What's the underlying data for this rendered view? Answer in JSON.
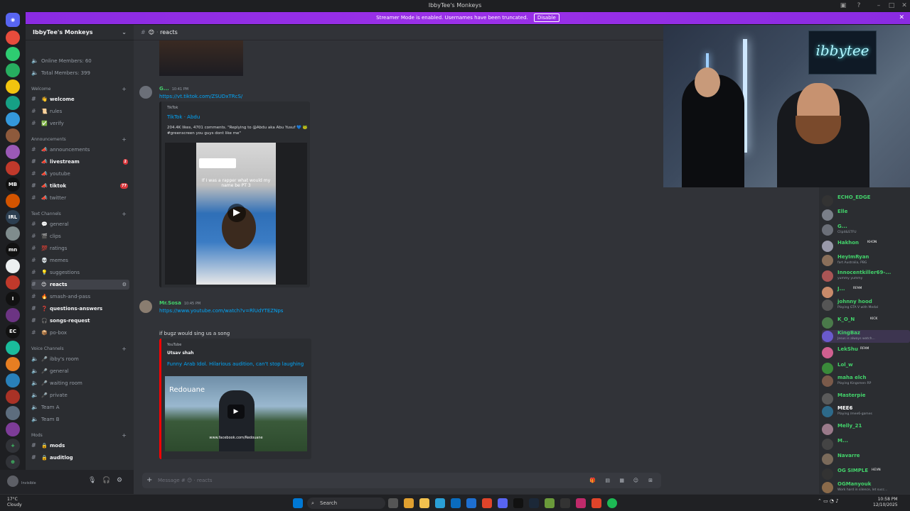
{
  "window": {
    "title": "IbbyTee's Monkeys"
  },
  "banner": {
    "text": "Streamer Mode is enabled. Usernames have been truncated.",
    "disable_label": "Disable"
  },
  "server": {
    "name": "IbbyTee's Monkeys"
  },
  "sidebar": {
    "stats": [
      {
        "label": "Online Members: 60"
      },
      {
        "label": "Total Members: 399"
      }
    ],
    "categories": {
      "welcome": "Welcome",
      "announcements": "Announcements",
      "text": "Text Channels",
      "voice": "Voice Channels",
      "mods": "Mods"
    },
    "welcome_channels": [
      {
        "label": "welcome"
      },
      {
        "label": "rules"
      },
      {
        "label": "verify"
      }
    ],
    "announce_channels": [
      {
        "label": "announcements"
      },
      {
        "label": "livestream",
        "badge": "2"
      },
      {
        "label": "youtube"
      },
      {
        "label": "tiktok",
        "badge": "77"
      },
      {
        "label": "twitter"
      }
    ],
    "text_channels": [
      {
        "label": "general"
      },
      {
        "label": "clips"
      },
      {
        "label": "ratings"
      },
      {
        "label": "memes"
      },
      {
        "label": "suggestions"
      },
      {
        "label": "reacts"
      },
      {
        "label": "smash-and-pass"
      },
      {
        "label": "questions-answers"
      },
      {
        "label": "songs-request"
      },
      {
        "label": "po-box"
      }
    ],
    "voice_channels": [
      {
        "label": "ibby's room"
      },
      {
        "label": "general"
      },
      {
        "label": "waiting room"
      },
      {
        "label": "private"
      },
      {
        "label": "Team A"
      },
      {
        "label": "Team B"
      }
    ],
    "mod_channels": [
      {
        "label": "mods"
      },
      {
        "label": "auditlog"
      }
    ]
  },
  "user": {
    "status": "Invisible"
  },
  "channel": {
    "name": "reacts"
  },
  "messages": {
    "m1": {
      "author": "G...",
      "time": "10:41 PM",
      "link": "https://vt.tiktok.com/ZSUDxTRcS/",
      "embed_provider": "TikTok",
      "embed_title": "TikTok · Abdu",
      "embed_desc": "204.4K likes, 4701 comments. \"Replying to @Abdu  aka  Abu  Yusuf 💙 🐸 #greenscreen you guys dont like me\"",
      "thumb_caption": "If I was a rapper what would my name be PT 3"
    },
    "m2": {
      "author": "Mr.Sosa",
      "time": "10:45 PM",
      "link": "https://www.youtube.com/watch?v=RlUdYTEZNps",
      "text": "if bugz would sing us a song",
      "embed_provider": "YouTube",
      "embed_author": "Utsav shah",
      "embed_title": "Funny Arab Idol. Hilarious audition, can't stop laughing",
      "thumb_text": "Redouane",
      "thumb_url": "www.facebook.com/Redouane"
    }
  },
  "composer": {
    "placeholder": "Message # 😊 · reacts"
  },
  "webcam": {
    "neon_text": "ibbytee"
  },
  "members": [
    {
      "name": "ECHO_EDGE",
      "status": ""
    },
    {
      "name": "Elle",
      "status": ""
    },
    {
      "name": "G...",
      "status": "Clipit&STFU"
    },
    {
      "name": "Hakhon",
      "status": "KHON"
    },
    {
      "name": "HeyImRyan",
      "status": "fart Australia, PBG"
    },
    {
      "name": "Innocentkiller69-...",
      "status": "yummy yummy"
    },
    {
      "name": "J...",
      "status": "RFAM"
    },
    {
      "name": "johnny hood",
      "status": "Playing GTA V with Medal"
    },
    {
      "name": "K_O_N",
      "status": "KICK"
    },
    {
      "name": "KingBaz",
      "status": "Jesus is always watch..."
    },
    {
      "name": "LekShu",
      "status": "RFAM"
    },
    {
      "name": "Lol_w",
      "status": ""
    },
    {
      "name": "maha elch",
      "status": "Playing Kingsmen RP"
    },
    {
      "name": "Masterpie",
      "status": ""
    },
    {
      "name": "MEE6",
      "status": "Playing /mee6-games"
    },
    {
      "name": "Melly_21",
      "status": ""
    },
    {
      "name": "M...",
      "status": ""
    },
    {
      "name": "Navarre",
      "status": ""
    },
    {
      "name": "OG SIMPLE",
      "status": "HEVN"
    },
    {
      "name": "OGManyouk",
      "status": "Work hard in silence, let succ..."
    }
  ],
  "taskbar": {
    "weather_temp": "17°C",
    "weather_desc": "Cloudy",
    "search_label": "Search",
    "time": "10:58 PM",
    "date": "12/10/2025"
  },
  "colors": {
    "banner": "#8a2be2",
    "accent": "#5865f2",
    "online": "#43d36b",
    "link": "#00a8fc"
  }
}
